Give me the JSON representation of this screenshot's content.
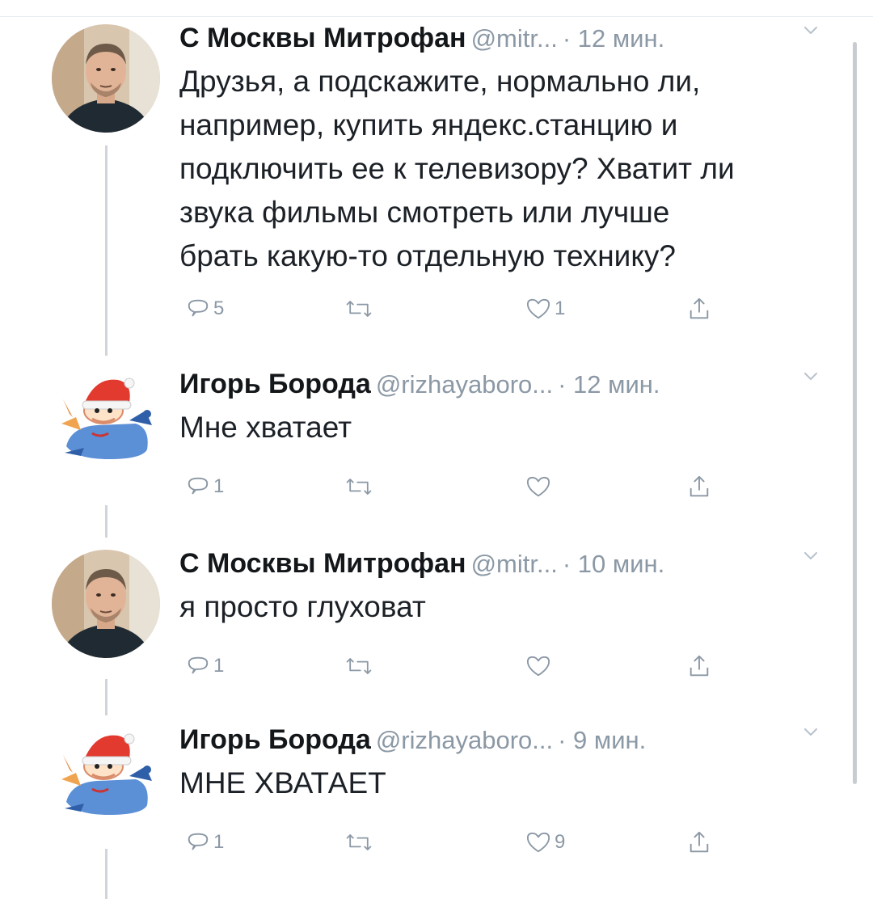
{
  "colors": {
    "name": "#14171a",
    "meta": "#8b98a5",
    "icon": "#8b98a5",
    "thread_line": "#cfd5da"
  },
  "tweets": [
    {
      "avatar_icon": "man-portrait-avatar",
      "name": "С Москвы Митрофан",
      "handle": "@mitr...",
      "time": "· 12 мин.",
      "lines": [
        "Друзья, а подскажите, нормально ли,",
        "например, купить яндекс.станцию и",
        "подключить ее к телевизору? Хватит ли",
        "звука фильмы смотреть или лучше",
        "брать какую-то отдельную технику?"
      ],
      "reply_count": "5",
      "retweet_count": "",
      "like_count": "1"
    },
    {
      "avatar_icon": "santa-cartoon-avatar",
      "name": "Игорь Борода",
      "handle": "@rizhayaboro...",
      "time": "· 12 мин.",
      "lines": [
        "Мне хватает"
      ],
      "reply_count": "1",
      "retweet_count": "",
      "like_count": ""
    },
    {
      "avatar_icon": "man-portrait-avatar",
      "name": "С Москвы Митрофан",
      "handle": "@mitr...",
      "time": "· 10 мин.",
      "lines": [
        "я просто глуховат"
      ],
      "reply_count": "1",
      "retweet_count": "",
      "like_count": ""
    },
    {
      "avatar_icon": "santa-cartoon-avatar",
      "name": "Игорь Борода",
      "handle": "@rizhayaboro...",
      "time": "· 9 мин.",
      "lines": [
        "МНЕ ХВАТАЕТ"
      ],
      "reply_count": "1",
      "retweet_count": "",
      "like_count": "9"
    }
  ]
}
